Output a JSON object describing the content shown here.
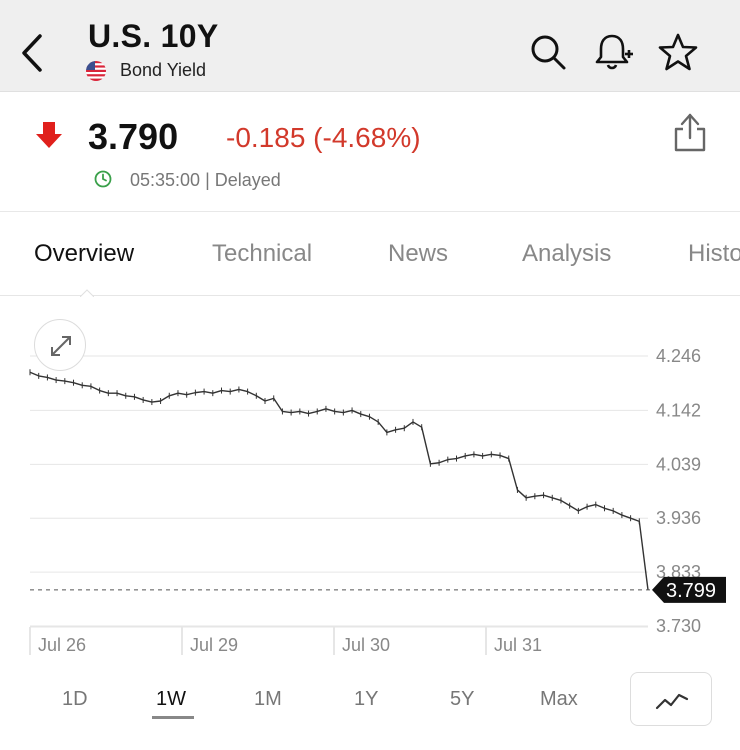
{
  "header": {
    "title": "U.S. 10Y",
    "subtitle": "Bond Yield",
    "icons": [
      "back-icon",
      "search-icon",
      "add-alert-icon",
      "star-icon"
    ]
  },
  "quote": {
    "price": "3.790",
    "change": "-0.185 (-4.68%)",
    "time": "05:35:00 | Delayed",
    "change_color": "#d2392b",
    "direction": "down"
  },
  "tabs": {
    "items": [
      "Overview",
      "Technical",
      "News",
      "Analysis",
      "Histo"
    ],
    "active": "Overview"
  },
  "ranges": {
    "items": [
      "1D",
      "1W",
      "1M",
      "1Y",
      "5Y",
      "Max"
    ],
    "active": "1W"
  },
  "chart_data": {
    "type": "line",
    "y_ticks": [
      "4.246",
      "4.142",
      "4.039",
      "3.936",
      "3.833",
      "3.730"
    ],
    "ylim": [
      3.73,
      4.246
    ],
    "x_ticks": [
      "Jul 26",
      "Jul 29",
      "Jul 30",
      "Jul 31"
    ],
    "last_value_label": "3.799",
    "current_price_line": 3.799,
    "series": [
      {
        "values": [
          4.215,
          4.208,
          4.205,
          4.2,
          4.198,
          4.195,
          4.19,
          4.188,
          4.18,
          4.175,
          4.175,
          4.17,
          4.168,
          4.162,
          4.158,
          4.16,
          4.17,
          4.175,
          4.172,
          4.176,
          4.178,
          4.175,
          4.18,
          4.178,
          4.182,
          4.178,
          4.17,
          4.16,
          4.165,
          4.14,
          4.138,
          4.14,
          4.136,
          4.14,
          4.145,
          4.14,
          4.138,
          4.142,
          4.135,
          4.13,
          4.12,
          4.1,
          4.105,
          4.108,
          4.12,
          4.11,
          4.04,
          4.042,
          4.048,
          4.05,
          4.055,
          4.058,
          4.055,
          4.058,
          4.056,
          4.05,
          3.99,
          3.975,
          3.978,
          3.98,
          3.975,
          3.97,
          3.96,
          3.95,
          3.958,
          3.962,
          3.955,
          3.95,
          3.942,
          3.936,
          3.93,
          3.799
        ]
      }
    ],
    "line_color": "#333333"
  }
}
